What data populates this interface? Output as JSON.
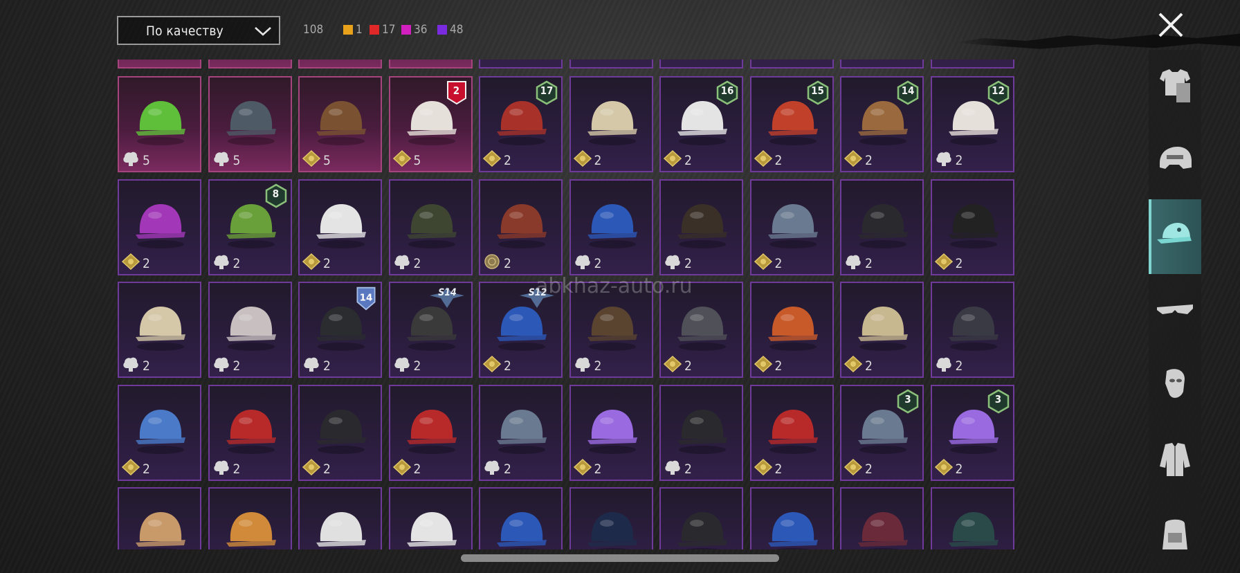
{
  "header": {
    "sort_label": "По качеству",
    "total_count": "108",
    "rarity_counts": [
      {
        "color": "#e8a11a",
        "count": "1"
      },
      {
        "color": "#e02828",
        "count": "17"
      },
      {
        "color": "#d21fc0",
        "count": "36"
      },
      {
        "color": "#7a2be0",
        "count": "48"
      }
    ]
  },
  "watermark": "abkhaz-auto.ru",
  "sidebar": {
    "tabs": [
      {
        "icon": "outfit-icon",
        "active": false
      },
      {
        "icon": "helmet-icon",
        "active": false
      },
      {
        "icon": "cap-icon",
        "active": true
      },
      {
        "icon": "glasses-icon",
        "active": false
      },
      {
        "icon": "mask-icon",
        "active": false
      },
      {
        "icon": "jacket-icon",
        "active": false
      },
      {
        "icon": "backpack-icon",
        "active": false
      }
    ]
  },
  "grid": {
    "rows": [
      [
        {
          "name": "frog-cop-hat",
          "currency": "silver",
          "cost": "5",
          "tier": "pink",
          "badge": ""
        },
        {
          "name": "gas-mask-helmet",
          "currency": "silver",
          "cost": "5",
          "tier": "pink",
          "badge": ""
        },
        {
          "name": "bear-head",
          "currency": "gold",
          "cost": "5",
          "tier": "pink",
          "badge": ""
        },
        {
          "name": "bunny-head",
          "currency": "gold",
          "cost": "5",
          "tier": "pink",
          "badge": "2"
        },
        {
          "name": "crowned-red-hair",
          "currency": "gold",
          "cost": "2",
          "tier": "purple",
          "badge": "17"
        },
        {
          "name": "goggle-helmets",
          "currency": "gold",
          "cost": "2",
          "tier": "purple",
          "badge": ""
        },
        {
          "name": "white-beanie",
          "currency": "gold",
          "cost": "2",
          "tier": "purple",
          "badge": "16"
        },
        {
          "name": "pumpkin-beanie",
          "currency": "gold",
          "cost": "2",
          "tier": "purple",
          "badge": "15"
        },
        {
          "name": "cat-ear-cap",
          "currency": "gold",
          "cost": "2",
          "tier": "purple",
          "badge": "14"
        },
        {
          "name": "bunny-helmet",
          "currency": "silver",
          "cost": "2",
          "tier": "purple",
          "badge": "12"
        }
      ],
      [
        {
          "name": "devil-horns",
          "currency": "gold",
          "cost": "2",
          "tier": "purple",
          "badge": ""
        },
        {
          "name": "alien-hood",
          "currency": "silver",
          "cost": "2",
          "tier": "purple",
          "badge": "8"
        },
        {
          "name": "white-blue-cap",
          "currency": "gold",
          "cost": "2",
          "tier": "purple",
          "badge": ""
        },
        {
          "name": "tactical-helmet",
          "currency": "silver",
          "cost": "2",
          "tier": "purple",
          "badge": ""
        },
        {
          "name": "aviator-hair",
          "currency": "coin",
          "cost": "2",
          "tier": "purple",
          "badge": ""
        },
        {
          "name": "blue-batting-helmet",
          "currency": "silver",
          "cost": "2",
          "tier": "purple",
          "badge": ""
        },
        {
          "name": "steampunk-hat",
          "currency": "silver",
          "cost": "2",
          "tier": "purple",
          "badge": ""
        },
        {
          "name": "grey-cap",
          "currency": "gold",
          "cost": "2",
          "tier": "purple",
          "badge": ""
        },
        {
          "name": "black-gas-mask",
          "currency": "silver",
          "cost": "2",
          "tier": "purple",
          "badge": ""
        },
        {
          "name": "gold-band-fedora",
          "currency": "gold",
          "cost": "2",
          "tier": "purple",
          "badge": ""
        }
      ],
      [
        {
          "name": "goggle-beanie",
          "currency": "silver",
          "cost": "2",
          "tier": "purple",
          "badge": ""
        },
        {
          "name": "oni-mask",
          "currency": "silver",
          "cost": "2",
          "tier": "purple",
          "badge": ""
        },
        {
          "name": "officer-cap",
          "currency": "silver",
          "cost": "2",
          "tier": "purple",
          "badge": "14-season"
        },
        {
          "name": "spartan-helmet",
          "currency": "silver",
          "cost": "2",
          "tier": "purple",
          "badge": "S14"
        },
        {
          "name": "blue-visor-helmet",
          "currency": "gold",
          "cost": "2",
          "tier": "purple",
          "badge": "S12"
        },
        {
          "name": "leather-aviator-cap",
          "currency": "silver",
          "cost": "2",
          "tier": "purple",
          "badge": ""
        },
        {
          "name": "dark-cap",
          "currency": "gold",
          "cost": "2",
          "tier": "purple",
          "badge": ""
        },
        {
          "name": "football-helmet",
          "currency": "gold",
          "cost": "2",
          "tier": "purple",
          "badge": ""
        },
        {
          "name": "scarecrow-hat",
          "currency": "gold",
          "cost": "2",
          "tier": "purple",
          "badge": ""
        },
        {
          "name": "luchador-mask",
          "currency": "silver",
          "cost": "2",
          "tier": "purple",
          "badge": ""
        }
      ],
      [
        {
          "name": "shark-hat",
          "currency": "gold",
          "cost": "2",
          "tier": "purple",
          "badge": ""
        },
        {
          "name": "red-beret",
          "currency": "silver",
          "cost": "2",
          "tier": "purple",
          "badge": ""
        },
        {
          "name": "black-top-hat",
          "currency": "gold",
          "cost": "2",
          "tier": "purple",
          "badge": ""
        },
        {
          "name": "red-fedora",
          "currency": "gold",
          "cost": "2",
          "tier": "purple",
          "badge": ""
        },
        {
          "name": "grey-shark-head",
          "currency": "silver",
          "cost": "2",
          "tier": "purple",
          "badge": ""
        },
        {
          "name": "flower-crown-purple",
          "currency": "gold",
          "cost": "2",
          "tier": "purple",
          "badge": ""
        },
        {
          "name": "hazard-mask",
          "currency": "silver",
          "cost": "2",
          "tier": "purple",
          "badge": ""
        },
        {
          "name": "red-bucket-hat",
          "currency": "gold",
          "cost": "2",
          "tier": "purple",
          "badge": ""
        },
        {
          "name": "grey-fedora",
          "currency": "gold",
          "cost": "2",
          "tier": "purple",
          "badge": "3"
        },
        {
          "name": "flower-crown-white",
          "currency": "gold",
          "cost": "2",
          "tier": "purple",
          "badge": "3"
        }
      ],
      [
        {
          "name": "ice-cream-hat",
          "currency": "",
          "cost": "",
          "tier": "purple",
          "badge": ""
        },
        {
          "name": "burger-hat",
          "currency": "",
          "cost": "",
          "tier": "purple",
          "badge": ""
        },
        {
          "name": "doctor-headlamp",
          "currency": "",
          "cost": "",
          "tier": "purple",
          "badge": ""
        },
        {
          "name": "white-captain-cap",
          "currency": "",
          "cost": "",
          "tier": "purple",
          "badge": ""
        },
        {
          "name": "blue-captain-cap",
          "currency": "",
          "cost": "",
          "tier": "purple",
          "badge": ""
        },
        {
          "name": "navy-beanie",
          "currency": "",
          "cost": "",
          "tier": "purple",
          "badge": ""
        },
        {
          "name": "black-logo-cap",
          "currency": "",
          "cost": "",
          "tier": "purple",
          "badge": ""
        },
        {
          "name": "blue-cap",
          "currency": "",
          "cost": "",
          "tier": "purple",
          "badge": ""
        },
        {
          "name": "maroon-fedora",
          "currency": "",
          "cost": "",
          "tier": "purple",
          "badge": ""
        },
        {
          "name": "plaid-helmet",
          "currency": "",
          "cost": "",
          "tier": "purple",
          "badge": ""
        }
      ]
    ]
  }
}
